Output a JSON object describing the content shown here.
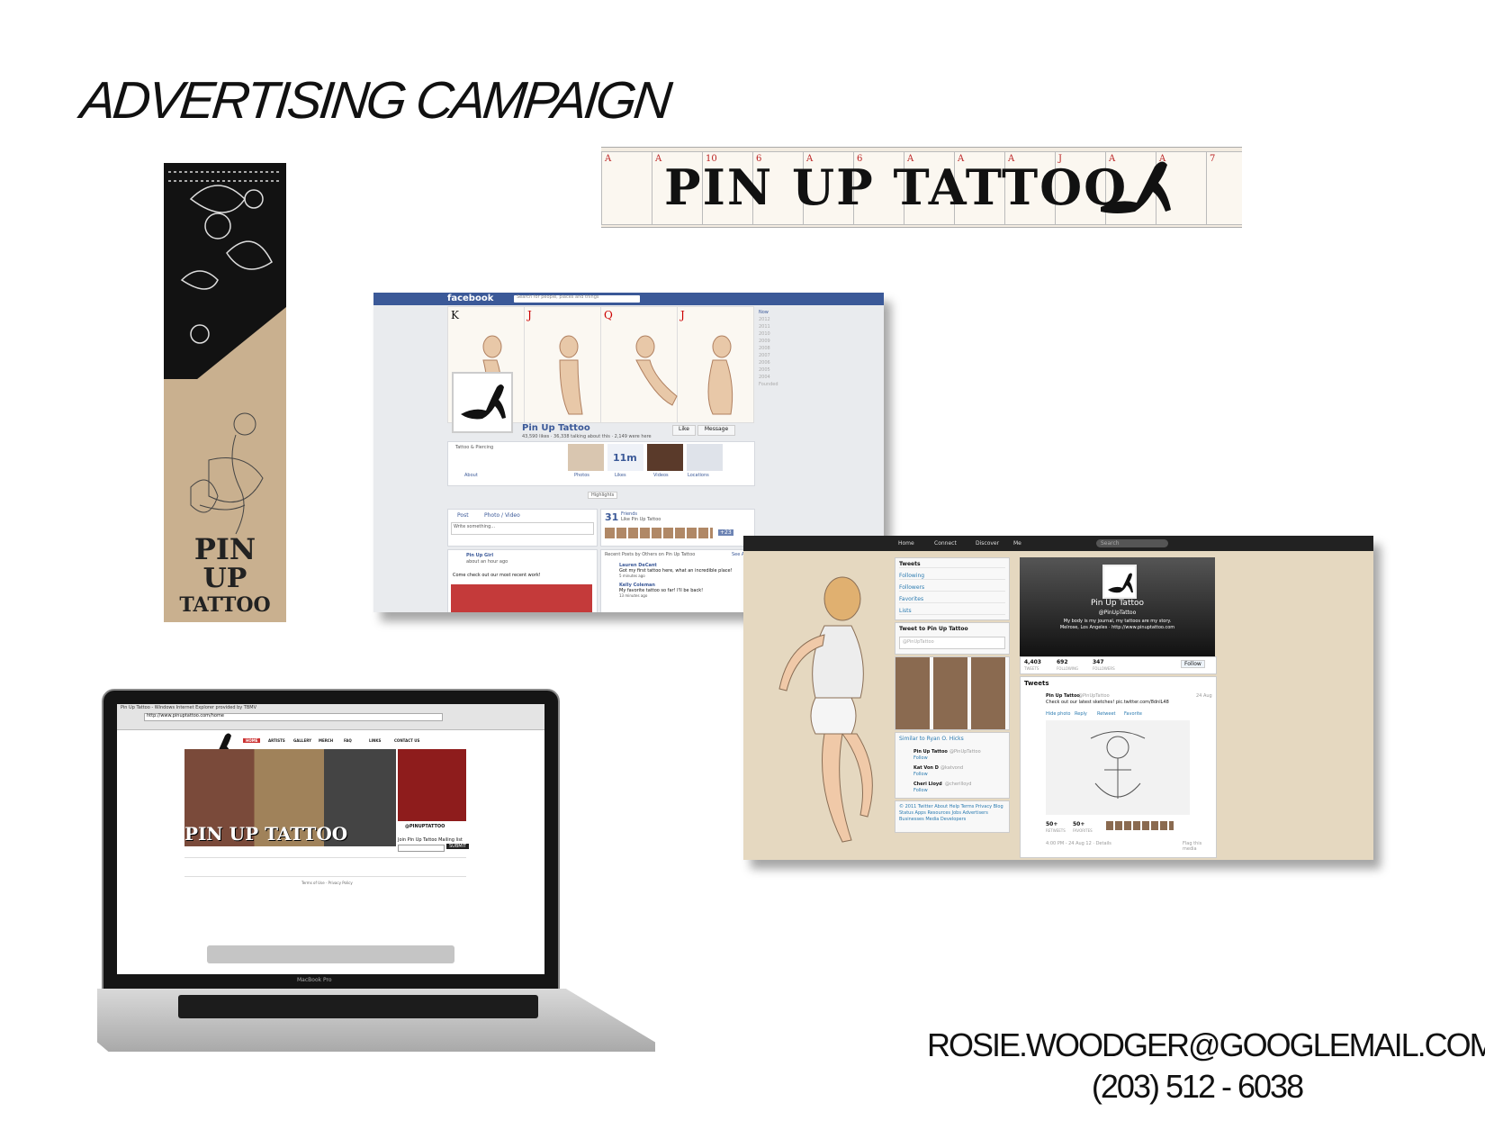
{
  "page": {
    "title": "ADVERTISING CAMPAIGN",
    "contact_email": "ROSIE.WOODGER@GOOGLEMAIL.COM",
    "contact_phone": "(203) 512 - 6038"
  },
  "bookmark": {
    "line1": "PIN",
    "line2": "UP",
    "line3": "TATTOO"
  },
  "banner": {
    "text": "PIN UP TATTOO",
    "card_ranks": [
      "A",
      "A",
      "10",
      "6",
      "A",
      "6",
      "A",
      "A",
      "A",
      "J",
      "A",
      "A",
      "7"
    ]
  },
  "facebook": {
    "logo": "facebook",
    "search_placeholder": "Search for people, places and things",
    "cards": [
      "K",
      "J",
      "Q",
      "J"
    ],
    "page_name": "Pin Up Tattoo",
    "page_stats": "43,590 likes · 36,338 talking about this · 2,149 were here",
    "like_button": "Like",
    "message_button": "Message",
    "category": "Tattoo & Piercing",
    "about": "About",
    "tabs": [
      "Photos",
      "Likes",
      "Videos",
      "Locations"
    ],
    "likes_count": "11m",
    "highlights": "Highlights",
    "post_tab": "Post",
    "photo_tab": "Photo / Video",
    "write_placeholder": "Write something...",
    "friends_count": "31",
    "friends_label": "Friends",
    "friends_sub": "Like Pin Up Tattoo",
    "friends_more": "+23",
    "post_author": "Pin Up Girl",
    "post_time": "about an hour ago",
    "post_text": "Come check out our most recent work!",
    "recent_title": "Recent Posts by Others on Pin Up Tattoo",
    "see_all": "See All",
    "comment1_name": "Lauren DeCant",
    "comment1_text": "Got my first tattoo here, what an incredible place!",
    "comment1_time": "5 minutes ago",
    "comment2_name": "Kelly Coleman",
    "comment2_text": "My favorite tattoo so far! I'll be back!",
    "comment2_time": "13 minutes ago",
    "years": [
      "Now",
      "2012",
      "2011",
      "2010",
      "2009",
      "2008",
      "2007",
      "2006",
      "2005",
      "2004",
      "Founded"
    ]
  },
  "twitter": {
    "nav": [
      "Home",
      "Connect",
      "Discover",
      "Me"
    ],
    "search_placeholder": "Search",
    "menu": [
      "Tweets",
      "Following",
      "Followers",
      "Favorites",
      "Lists"
    ],
    "tweet_to": "Tweet to Pin Up Tattoo",
    "tweet_to_placeholder": "@PinUpTattoo",
    "profile_name": "Pin Up Tattoo",
    "profile_handle": "@PinUpTattoo",
    "profile_bio": "My body is my journal, my tattoos are my story.",
    "profile_location": "Melrose, Los Angeles · http://www.pinuptattoo.com",
    "stats": [
      {
        "value": "4,403",
        "label": "TWEETS"
      },
      {
        "value": "692",
        "label": "FOLLOWING"
      },
      {
        "value": "347",
        "label": "FOLLOWERS"
      }
    ],
    "follow_button": "Follow",
    "tweets_header": "Tweets",
    "tweet_author": "Pin Up Tattoo",
    "tweet_handle": "@PinUpTattoo",
    "tweet_date": "24 Aug",
    "tweet_text": "Check out our latest sketches! pic.twitter.com/8dnlL48",
    "tweet_actions": [
      "Hide photo",
      "Reply",
      "Retweet",
      "Favorite"
    ],
    "retweets": "50+",
    "retweets_label": "RETWEETS",
    "favorites": "50+",
    "favorites_label": "FAVORITES",
    "tweet_footer": "4:00 PM - 24 Aug 12 · Details",
    "flag_media": "Flag this media",
    "similar_title": "Similar to Ryan O. Hicks",
    "similar": [
      {
        "name": "Pin Up Tattoo",
        "handle": "@PinUpTattoo",
        "action": "Follow"
      },
      {
        "name": "Kat Von D",
        "handle": "@katvond",
        "action": "Follow"
      },
      {
        "name": "Cheri Lloyd",
        "handle": "@cherilloyd",
        "action": "Follow"
      }
    ],
    "footer_links": "© 2011 Twitter About Help Terms Privacy Blog Status Apps Resources Jobs Advertisers Businesses Media Developers"
  },
  "laptop": {
    "browser_title": "Pin Up Tattoo - Windows Internet Explorer provided by TBMV",
    "url": "http://www.pinuptattoo.com/home",
    "nav": [
      "HOME",
      "ARTISTS",
      "GALLERY",
      "MERCH",
      "FAQ",
      "LINKS",
      "CONTACT US"
    ],
    "hero_text": "PIN UP TATTOO",
    "handle": "@PINUPTATTOO",
    "join_text": "Join Pin Up Tattoo Mailing list",
    "submit": "SUBMIT",
    "footer": "Terms of Use · Privacy Policy",
    "model": "MacBook Pro"
  },
  "colors": {
    "facebook_blue": "#3b5998",
    "bookmark_tan": "#c9b08f",
    "twitter_bg": "#e5d8c0"
  }
}
